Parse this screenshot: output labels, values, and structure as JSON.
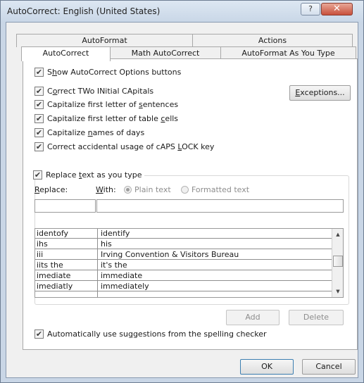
{
  "window": {
    "title": "AutoCorrect: English (United States)",
    "help_label": "?",
    "close_label": "✕"
  },
  "tabs_top": [
    "AutoFormat",
    "Actions"
  ],
  "tabs_bottom": [
    "AutoCorrect",
    "Math AutoCorrect",
    "AutoFormat As You Type"
  ],
  "active_tab": "AutoCorrect",
  "options": {
    "show_buttons": {
      "pre": "S",
      "ul": "h",
      "post": "ow AutoCorrect Options buttons",
      "checked": true
    },
    "correct_two": {
      "pre": "C",
      "ul": "o",
      "post": "rrect TWo INitial CApitals",
      "checked": true
    },
    "cap_sentences": {
      "pre": "Capitalize first letter of ",
      "ul": "s",
      "post": "entences",
      "checked": true
    },
    "cap_cells": {
      "pre": "Capitalize first letter of table ",
      "ul": "c",
      "post": "ells",
      "checked": true
    },
    "cap_days": {
      "pre": "Capitalize ",
      "ul": "n",
      "post": "ames of days",
      "checked": true
    },
    "caps_lock": {
      "pre": "Correct accidental usage of cAPS ",
      "ul": "L",
      "post": "OCK key",
      "checked": true
    },
    "replace_text": {
      "pre": "Replace ",
      "ul": "t",
      "post": "ext as you type",
      "checked": true
    },
    "auto_suggest": {
      "pre": "Automatically use su",
      "ul": "g",
      "post": "gestions from the spelling checker",
      "checked": true
    }
  },
  "exceptions_button": {
    "ul": "E",
    "rest": "xceptions..."
  },
  "replace_label": {
    "ul": "R",
    "rest": "eplace:"
  },
  "with_label": {
    "ul": "W",
    "rest": "ith:"
  },
  "radio_plain": {
    "label": "Plain text",
    "selected": true
  },
  "radio_formatted": {
    "label": "Formatted text",
    "selected": false
  },
  "replace_input": {
    "value": ""
  },
  "with_input": {
    "value": ""
  },
  "entries": [
    {
      "replace": "identofy",
      "with": "identify"
    },
    {
      "replace": "ihs",
      "with": "his"
    },
    {
      "replace": "iii",
      "with": "Irving Convention & Visitors Bureau"
    },
    {
      "replace": "iits the",
      "with": "it's the"
    },
    {
      "replace": "imediate",
      "with": "immediate"
    },
    {
      "replace": "imediatly",
      "with": "immediately"
    }
  ],
  "add_button": "Add",
  "delete_button": "Delete",
  "ok_button": "OK",
  "cancel_button": "Cancel",
  "check_mark": "✔"
}
